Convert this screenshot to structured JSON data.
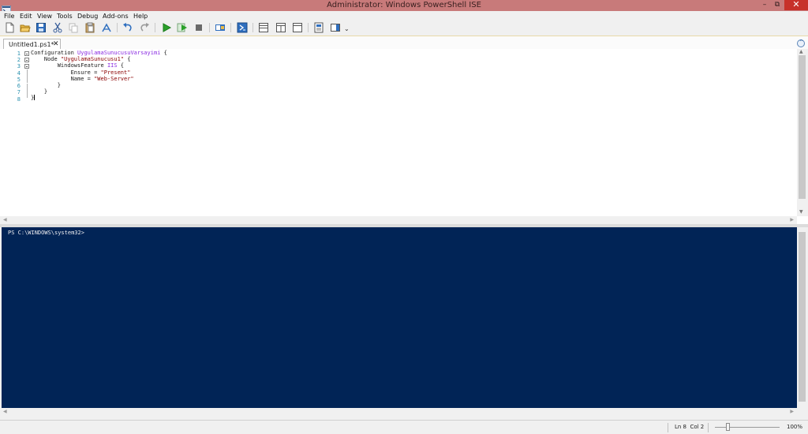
{
  "window": {
    "title": "Administrator: Windows PowerShell ISE",
    "minimize_glyph": "–",
    "restore_glyph": "⧉",
    "close_glyph": "✕"
  },
  "menu": [
    "File",
    "Edit",
    "View",
    "Tools",
    "Debug",
    "Add-ons",
    "Help"
  ],
  "toolbar": {
    "icons": [
      "new-file-icon",
      "open-file-icon",
      "save-icon",
      "cut-icon",
      "copy-icon",
      "paste-icon",
      "clear-console-icon",
      "undo-icon",
      "redo-icon",
      "run-script-icon",
      "run-selection-icon",
      "stop-icon",
      "new-remote-tab-icon",
      "start-powershell-icon",
      "show-script-pane-top-icon",
      "show-script-pane-right-icon",
      "show-script-pane-maximized-icon",
      "show-command-window-icon",
      "show-command-addon-icon"
    ],
    "overflow": "⌄"
  },
  "editor": {
    "tab_label": "Untitled1.ps1*",
    "tab_close": "✕",
    "line_numbers": [
      "1",
      "2",
      "3",
      "4",
      "5",
      "6",
      "7",
      "8"
    ],
    "lines": [
      [
        {
          "t": "Configuration ",
          "c": "kw"
        },
        {
          "t": "UygulamaSunucusuVarsayimi",
          "c": "nm"
        },
        {
          "t": " {",
          "c": "pl"
        }
      ],
      [
        {
          "t": "    Node ",
          "c": "kw"
        },
        {
          "t": "\"UygulamaSunucusu1\"",
          "c": "str"
        },
        {
          "t": " {",
          "c": "pl"
        }
      ],
      [
        {
          "t": "        WindowsFeature ",
          "c": "kw"
        },
        {
          "t": "IIS",
          "c": "nm"
        },
        {
          "t": " {",
          "c": "pl"
        }
      ],
      [
        {
          "t": "            Ensure = ",
          "c": "pl"
        },
        {
          "t": "\"Present\"",
          "c": "str"
        }
      ],
      [
        {
          "t": "            Name = ",
          "c": "pl"
        },
        {
          "t": "\"Web-Server\"",
          "c": "str"
        }
      ],
      [
        {
          "t": "        }",
          "c": "pl"
        }
      ],
      [
        {
          "t": "    }",
          "c": "pl"
        }
      ],
      [
        {
          "t": "}",
          "c": "pl"
        }
      ]
    ]
  },
  "console": {
    "prompt": "PS C:\\WINDOWS\\system32>"
  },
  "statusbar": {
    "position": "Ln 8  Col 2",
    "zoom": "100%",
    "zoom_level": 0.2
  },
  "colors": {
    "titlebar": "#c87a7a",
    "console_bg": "#012456",
    "console_fg": "#eeedf0",
    "keyword": "#1a1a1a",
    "name": "#8a2be2",
    "string": "#8b0000",
    "line_number": "#2b91af"
  }
}
